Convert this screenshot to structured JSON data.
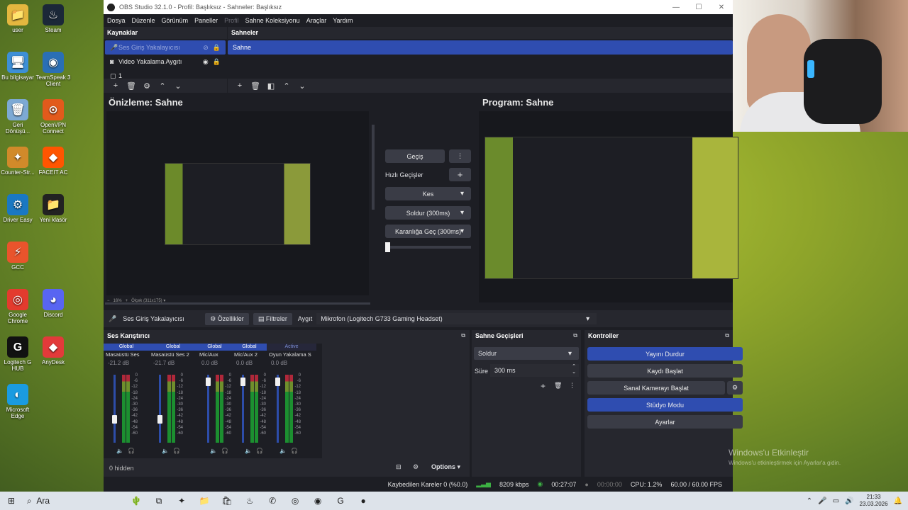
{
  "desktop": {
    "icons": [
      {
        "label": "user",
        "glyph": "📁",
        "color": "#e4b73f"
      },
      {
        "label": "Steam",
        "glyph": "♨",
        "color": "#1b2838"
      },
      {
        "label": "Bu bilgisayar",
        "glyph": "🖥",
        "color": "#3d8fd6"
      },
      {
        "label": "TeamSpeak 3 Client",
        "glyph": "◉",
        "color": "#2a6fb5"
      },
      {
        "label": "Geri Dönüşü...",
        "glyph": "🗑",
        "color": "#7da9d4"
      },
      {
        "label": "OpenVPN Connect",
        "glyph": "⊙",
        "color": "#e25a1c"
      },
      {
        "label": "Counter-Str...",
        "glyph": "✦",
        "color": "#d18a2a"
      },
      {
        "label": "FACEIT AC",
        "glyph": "◆",
        "color": "#ff5500"
      },
      {
        "label": "Driver Easy",
        "glyph": "⚙",
        "color": "#1a78c2"
      },
      {
        "label": "Yeni klasör",
        "glyph": "📁",
        "color": "#222"
      },
      {
        "label": "GCC",
        "glyph": "⚡",
        "color": "#e9542c"
      },
      {
        "label": "",
        "glyph": "",
        "color": "transparent"
      },
      {
        "label": "Google Chrome",
        "glyph": "◎",
        "color": "#e33b2e"
      },
      {
        "label": "Discord",
        "glyph": "◕",
        "color": "#5865f2"
      },
      {
        "label": "Logitech G HUB",
        "glyph": "G",
        "color": "#111"
      },
      {
        "label": "AnyDesk",
        "glyph": "◆",
        "color": "#e23a3a"
      },
      {
        "label": "Microsoft Edge",
        "glyph": "◐",
        "color": "#1a9be0"
      }
    ]
  },
  "window": {
    "title": "OBS Studio 32.1.0 - Profil: Başlıksız - Sahneler: Başlıksız",
    "minimize": "—",
    "maximize": "☐",
    "close": "✕"
  },
  "menu": {
    "items": [
      "Dosya",
      "Düzenle",
      "Görünüm",
      "Paneller",
      "Profil",
      "Sahne Koleksiyonu",
      "Araçlar",
      "Yardım"
    ]
  },
  "sources": {
    "title": "Kaynaklar",
    "items": [
      {
        "label": "Ses Giriş Yakalayıcısı",
        "icon": "🎤"
      },
      {
        "label": "Video Yakalama Aygıtı",
        "icon": "◙"
      },
      {
        "label": "1",
        "icon": "▢"
      }
    ]
  },
  "scenes": {
    "title": "Sahneler",
    "items": [
      "Sahne"
    ]
  },
  "preview": {
    "label": "Önizleme: Sahne",
    "zoom": "16%",
    "size": "Ölçek (311x175)"
  },
  "program": {
    "label": "Program: Sahne"
  },
  "transitions": {
    "swap": "Geçiş",
    "quick": "Hızlı Geçişler",
    "cut": "Kes",
    "fade": "Soldur (300ms)",
    "fade_black": "Karanlığa Geç (300ms)"
  },
  "context": {
    "source": "Ses Giriş Yakalayıcısı",
    "props": "Özellikler",
    "filters": "Filtreler",
    "device_label": "Aygıt",
    "device": "Mikrofon (Logitech G733 Gaming Headset)"
  },
  "mixer": {
    "title": "Ses Karıştırıcı",
    "hidden": "0 hidden",
    "options": "Options",
    "channels": [
      {
        "head": "Global",
        "name": "Masaüstü Ses",
        "db": "-21.2 dB",
        "level": 0.35
      },
      {
        "head": "Global",
        "name": "Masaüstü Ses 2",
        "db": "-21.7 dB",
        "level": 0.35
      },
      {
        "head": "Global",
        "name": "Mic/Aux",
        "db": "0.0 dB",
        "level": 0.95
      },
      {
        "head": "Global",
        "name": "Mic/Aux 2",
        "db": "0.0 dB",
        "level": 0.95
      },
      {
        "head": "Active",
        "name": "Oyun Yakalama S",
        "db": "0.0 dB",
        "level": 0.95
      }
    ],
    "scale": [
      "0",
      "-6",
      "-12",
      "-18",
      "-24",
      "-30",
      "-36",
      "-42",
      "-48",
      "-54",
      "-60"
    ]
  },
  "scene_transitions": {
    "title": "Sahne Geçişleri",
    "type": "Soldur",
    "duration_label": "Süre",
    "duration": "300 ms"
  },
  "controls": {
    "title": "Kontroller",
    "stop_stream": "Yayını Durdur",
    "start_record": "Kaydı Başlat",
    "virtual_cam": "Sanal Kamerayı Başlat",
    "studio": "Stüdyo Modu",
    "settings": "Ayarlar"
  },
  "status": {
    "dropped": "Kaybedilen Kareler 0 (%0.0)",
    "bitrate": "8209 kbps",
    "stream_time": "00:27:07",
    "rec_time": "00:00:00",
    "cpu": "CPU: 1.2%",
    "fps": "60.00 / 60.00 FPS"
  },
  "watermark": {
    "line1": "Windows'u Etkinleştir",
    "line2": "Windows'u etkinleştirmek için Ayarlar'a gidin."
  },
  "taskbar": {
    "search": "Ara",
    "time": "21:33",
    "date": "23.03.2026"
  }
}
